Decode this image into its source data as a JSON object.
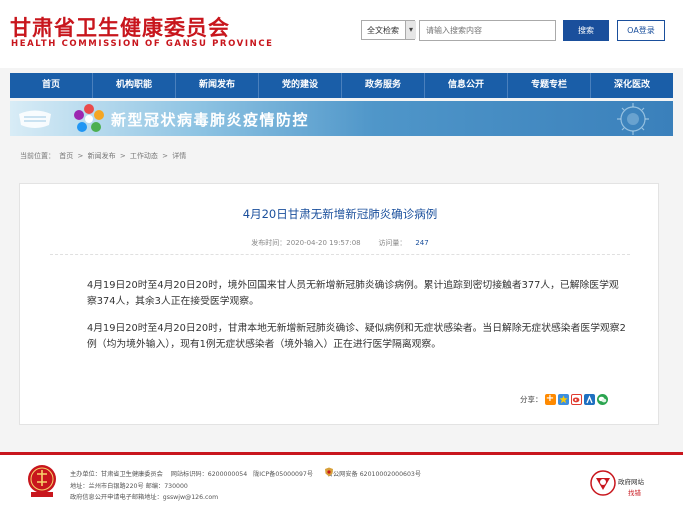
{
  "header": {
    "logo_cn": "甘肃省卫生健康委员会",
    "logo_en": "HEALTH COMMISSION OF GANSU PROVINCE",
    "search_scope": "全文检索",
    "search_placeholder": "请输入搜索内容",
    "search_button": "搜索",
    "oa_button": "OA登录"
  },
  "nav": {
    "items": [
      "首页",
      "机构职能",
      "新闻发布",
      "党的建设",
      "政务服务",
      "信息公开",
      "专题专栏",
      "深化医改"
    ]
  },
  "banner": {
    "text": "新型冠状病毒肺炎疫情防控"
  },
  "breadcrumb": {
    "label": "当前位置：",
    "items": [
      "首页",
      "新闻发布",
      "工作动态",
      "详情"
    ],
    "separator": ">"
  },
  "article": {
    "title": "4月20日甘肃无新增新冠肺炎确诊病例",
    "published_label": "发布时间：",
    "published_time": "2020-04-20 19:57:08",
    "views_label": "访问量：",
    "views": "247",
    "paragraph1": "4月19日20时至4月20日20时，境外回国来甘人员无新增新冠肺炎确诊病例。累计追踪到密切接触者377人，已解除医学观察374人，其余3人正在接受医学观察。",
    "paragraph2": "4月19日20时至4月20日20时，甘肃本地无新增新冠肺炎确诊、疑似病例和无症状感染者。当日解除无症状感染者医学观察2例（均为境外输入），现有1例无症状感染者（境外输入）正在进行医学隔离观察。",
    "share_label": "分享："
  },
  "footer": {
    "line1_sponsor": "主办单位：甘肃省卫生健康委员会",
    "line1_site_code": "网站标识码：6200000054",
    "line1_icp": "陇ICP备05000097号",
    "line1_police": "甘公网安备 62010002000603号",
    "line2": "地址：兰州市白银路220号    邮编：730000",
    "line3": "政府信息公开申请电子邮箱地址：gsswjw@126.com",
    "badge_title": "政府网站",
    "badge_subtitle": "找错"
  },
  "colors": {
    "brand_red": "#c8161d",
    "nav_blue": "#1a5ea8",
    "title_blue": "#1a4f9c"
  }
}
